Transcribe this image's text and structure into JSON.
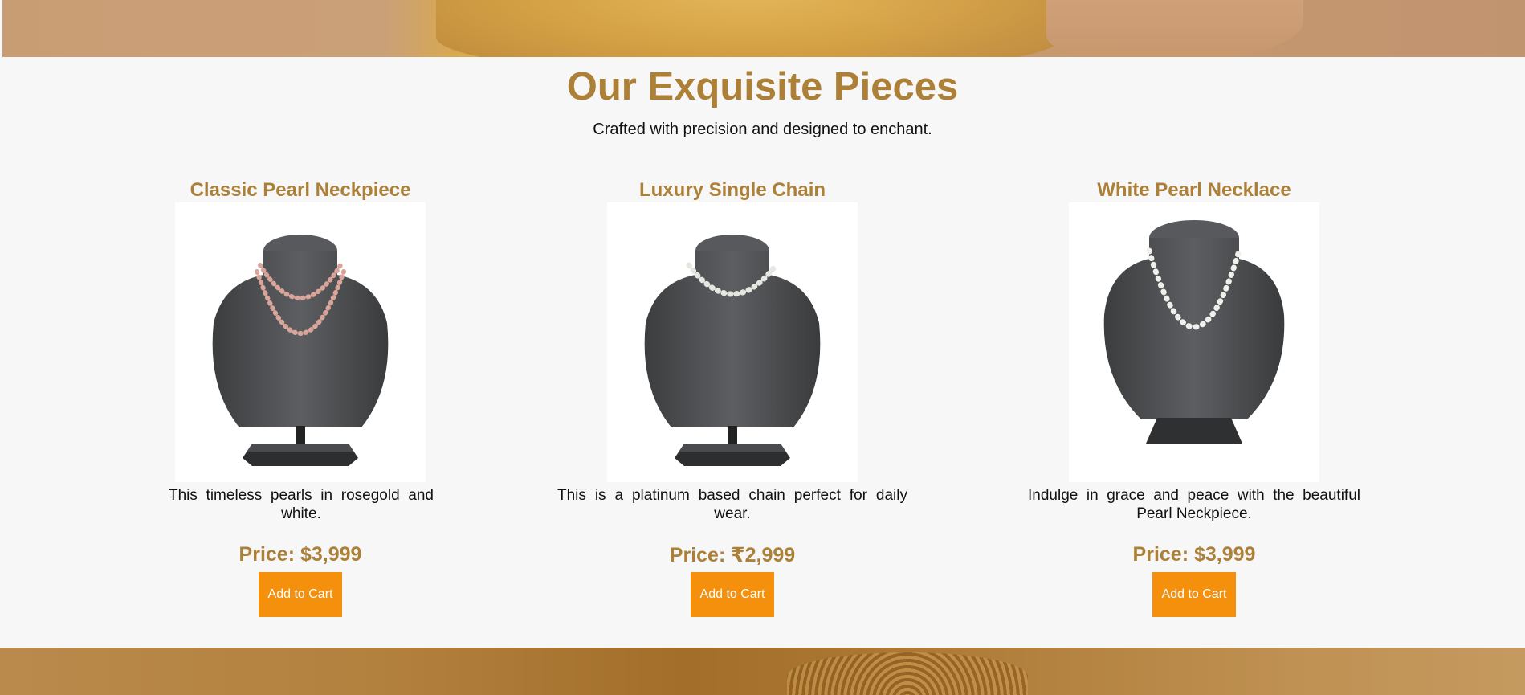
{
  "section": {
    "title": "Our Exquisite Pieces",
    "subtitle": "Crafted with precision and designed to enchant."
  },
  "products": [
    {
      "name": "Classic Pearl Neckpiece",
      "description": "This timeless pearls in rosegold and white.",
      "price": "Price: $3,999",
      "button": "Add to Cart",
      "bead_color": "#d9a49a",
      "strands": 2
    },
    {
      "name": "Luxury Single Chain",
      "description": "This is a platinum based chain perfect for daily wear.",
      "price": "Price: ₹2,999",
      "button": "Add to Cart",
      "bead_color": "#e7e7e2",
      "strands": 1
    },
    {
      "name": "White Pearl Necklace",
      "description": "Indulge in grace and peace with the beautiful Pearl Neckpiece.",
      "price": "Price: $3,999",
      "button": "Add to Cart",
      "bead_color": "#efefec",
      "strands": 1
    }
  ],
  "colors": {
    "accent": "#ad8038",
    "button": "#f4900c",
    "background": "#f7f7f7"
  }
}
